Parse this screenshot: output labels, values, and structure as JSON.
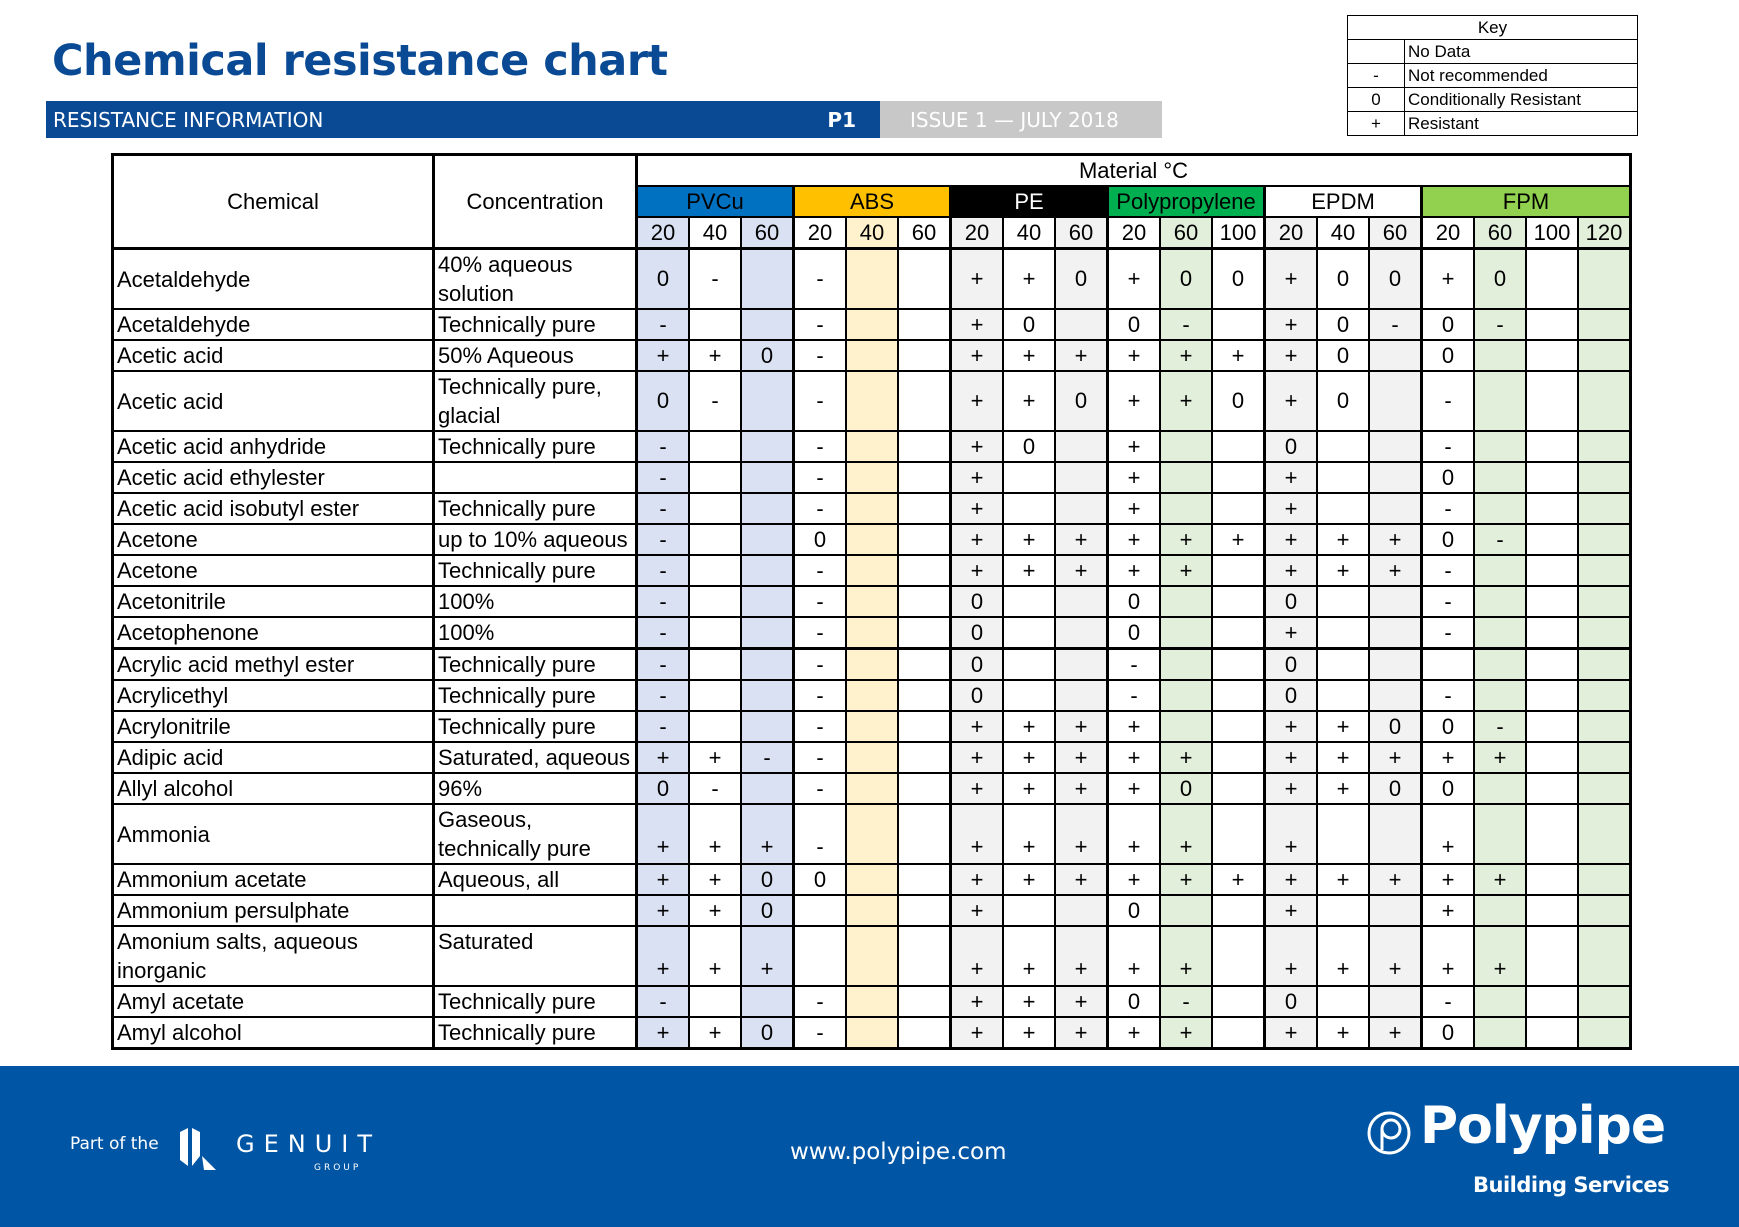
{
  "header": {
    "title": "Chemical resistance chart",
    "section": "RESISTANCE INFORMATION",
    "page": "P1",
    "issue": "ISSUE 1 — JULY 2018"
  },
  "key": {
    "title": "Key",
    "items": [
      {
        "symbol": "",
        "label": "No Data"
      },
      {
        "symbol": "-",
        "label": "Not recommended"
      },
      {
        "symbol": "0",
        "label": "Conditionally Resistant"
      },
      {
        "symbol": "+",
        "label": "Resistant"
      }
    ]
  },
  "table": {
    "col_chemical": "Chemical",
    "col_concentration": "Concentration",
    "material_title": "Material °C",
    "materials": [
      {
        "name": "PVCu",
        "color": "#0070c0",
        "text_color": "#000000",
        "temps": [
          "20",
          "40",
          "60"
        ],
        "shade": [
          true,
          false,
          true
        ],
        "shade_color": "#d9e1f2"
      },
      {
        "name": "ABS",
        "color": "#ffc000",
        "text_color": "#000000",
        "temps": [
          "20",
          "40",
          "60"
        ],
        "shade": [
          false,
          true,
          false
        ],
        "shade_color": "#fff2cc"
      },
      {
        "name": "PE",
        "color": "#000000",
        "text_color": "#ffffff",
        "temps": [
          "20",
          "40",
          "60"
        ],
        "shade": [
          true,
          false,
          true
        ],
        "shade_color": "#f2f2f2"
      },
      {
        "name": "Polypropylene",
        "color": "#00b050",
        "text_color": "#000000",
        "temps": [
          "20",
          "60",
          "100"
        ],
        "shade": [
          false,
          true,
          false
        ],
        "shade_color": "#e2efda"
      },
      {
        "name": "EPDM",
        "color": "#ffffff",
        "text_color": "#000000",
        "temps": [
          "20",
          "40",
          "60"
        ],
        "shade": [
          true,
          false,
          true
        ],
        "shade_color": "#f2f2f2"
      },
      {
        "name": "FPM",
        "color": "#92d050",
        "text_color": "#000000",
        "temps": [
          "20",
          "60",
          "100",
          "120"
        ],
        "shade": [
          false,
          true,
          false,
          true
        ],
        "shade_color": "#e2efda"
      }
    ],
    "rows": [
      {
        "chemical": "Acetaldehyde",
        "concentration": "40% aqueous solution",
        "tall": true,
        "values": [
          "0",
          "-",
          "",
          "-",
          "",
          "",
          "+",
          "+",
          "0",
          "+",
          "0",
          "0",
          "+",
          "0",
          "0",
          "+",
          "0",
          "",
          ""
        ]
      },
      {
        "chemical": "Acetaldehyde",
        "concentration": "Technically pure",
        "values": [
          "-",
          "",
          "",
          "-",
          "",
          "",
          "+",
          "0",
          "",
          "0",
          "-",
          "",
          "+",
          "0",
          "-",
          "0",
          "-",
          "",
          ""
        ]
      },
      {
        "chemical": "Acetic acid",
        "concentration": "50% Aqueous",
        "values": [
          "+",
          "+",
          "0",
          "-",
          "",
          "",
          "+",
          "+",
          "+",
          "+",
          "+",
          "+",
          "+",
          "0",
          "",
          "0",
          "",
          "",
          ""
        ]
      },
      {
        "chemical": "Acetic acid",
        "concentration": "Technically pure, glacial",
        "tall": true,
        "values": [
          "0",
          "-",
          "",
          "-",
          "",
          "",
          "+",
          "+",
          "0",
          "+",
          "+",
          "0",
          "+",
          "0",
          "",
          "-",
          "",
          "",
          ""
        ]
      },
      {
        "chemical": "Acetic acid anhydride",
        "concentration": "Technically pure",
        "values": [
          "-",
          "",
          "",
          "-",
          "",
          "",
          "+",
          "0",
          "",
          "+",
          "",
          "",
          "0",
          "",
          "",
          "-",
          "",
          "",
          ""
        ]
      },
      {
        "chemical": "Acetic acid ethylester",
        "concentration": "",
        "values": [
          "-",
          "",
          "",
          "-",
          "",
          "",
          "+",
          "",
          "",
          "+",
          "",
          "",
          "+",
          "",
          "",
          "0",
          "",
          "",
          ""
        ]
      },
      {
        "chemical": "Acetic acid isobutyl ester",
        "concentration": "Technically pure",
        "values": [
          "-",
          "",
          "",
          "-",
          "",
          "",
          "+",
          "",
          "",
          "+",
          "",
          "",
          "+",
          "",
          "",
          "-",
          "",
          "",
          ""
        ]
      },
      {
        "chemical": "Acetone",
        "concentration": "up to 10% aqueous",
        "values": [
          "-",
          "",
          "",
          "0",
          "",
          "",
          "+",
          "+",
          "+",
          "+",
          "+",
          "+",
          "+",
          "+",
          "+",
          "0",
          "-",
          "",
          ""
        ]
      },
      {
        "chemical": "Acetone",
        "concentration": "Technically pure",
        "values": [
          "-",
          "",
          "",
          "-",
          "",
          "",
          "+",
          "+",
          "+",
          "+",
          "+",
          "",
          "+",
          "+",
          "+",
          "-",
          "",
          "",
          ""
        ]
      },
      {
        "chemical": "Acetonitrile",
        "concentration": "100%",
        "values": [
          "-",
          "",
          "",
          "-",
          "",
          "",
          "0",
          "",
          "",
          "0",
          "",
          "",
          "0",
          "",
          "",
          "-",
          "",
          "",
          ""
        ]
      },
      {
        "chemical": "Acetophenone",
        "concentration": "100%",
        "values": [
          "-",
          "",
          "",
          "-",
          "",
          "",
          "0",
          "",
          "",
          "0",
          "",
          "",
          "+",
          "",
          "",
          "-",
          "",
          "",
          ""
        ]
      },
      {
        "chemical": "Acrylic acid methyl ester",
        "concentration": "Technically pure",
        "values": [
          "-",
          "",
          "",
          "-",
          "",
          "",
          "0",
          "",
          "",
          "-",
          "",
          "",
          "0",
          "",
          "",
          "",
          "",
          "",
          ""
        ]
      },
      {
        "chemical": "Acrylicethyl",
        "concentration": "Technically pure",
        "values": [
          "-",
          "",
          "",
          "-",
          "",
          "",
          "0",
          "",
          "",
          "-",
          "",
          "",
          "0",
          "",
          "",
          "-",
          "",
          "",
          ""
        ]
      },
      {
        "chemical": "Acrylonitrile",
        "concentration": "Technically pure",
        "values": [
          "-",
          "",
          "",
          "-",
          "",
          "",
          "+",
          "+",
          "+",
          "+",
          "",
          "",
          "+",
          "+",
          "0",
          "0",
          "-",
          "",
          ""
        ]
      },
      {
        "chemical": "Adipic acid",
        "concentration": "Saturated, aqueous",
        "values": [
          "+",
          "+",
          "-",
          "-",
          "",
          "",
          "+",
          "+",
          "+",
          "+",
          "+",
          "",
          "+",
          "+",
          "+",
          "+",
          "+",
          "",
          ""
        ]
      },
      {
        "chemical": "Allyl alcohol",
        "concentration": "96%",
        "values": [
          "0",
          "-",
          "",
          "-",
          "",
          "",
          "+",
          "+",
          "+",
          "+",
          "0",
          "",
          "+",
          "+",
          "0",
          "0",
          "",
          "",
          ""
        ]
      },
      {
        "chemical": "Ammonia",
        "concentration": "Gaseous, technically pure",
        "tall": true,
        "bottom": true,
        "values": [
          "+",
          "+",
          "+",
          "-",
          "",
          "",
          "+",
          "+",
          "+",
          "+",
          "+",
          "",
          "+",
          "",
          "",
          "+",
          "",
          "",
          ""
        ]
      },
      {
        "chemical": "Ammonium acetate",
        "concentration": "Aqueous, all",
        "values": [
          "+",
          "+",
          "0",
          "0",
          "",
          "",
          "+",
          "+",
          "+",
          "+",
          "+",
          "+",
          "+",
          "+",
          "+",
          "+",
          "+",
          "",
          ""
        ]
      },
      {
        "chemical": "Ammonium persulphate",
        "concentration": "",
        "values": [
          "+",
          "+",
          "0",
          "",
          "",
          "",
          "+",
          "",
          "",
          "0",
          "",
          "",
          "+",
          "",
          "",
          "+",
          "",
          "",
          ""
        ]
      },
      {
        "chemical": "Amonium salts, aqueous inorganic",
        "concentration": "Saturated",
        "tall": true,
        "bottom": true,
        "values": [
          "+",
          "+",
          "+",
          "",
          "",
          "",
          "+",
          "+",
          "+",
          "+",
          "+",
          "",
          "+",
          "+",
          "+",
          "+",
          "+",
          "",
          ""
        ]
      },
      {
        "chemical": "Amyl acetate",
        "concentration": "Technically pure",
        "values": [
          "-",
          "",
          "",
          "-",
          "",
          "",
          "+",
          "+",
          "+",
          "0",
          "-",
          "",
          "0",
          "",
          "",
          "-",
          "",
          "",
          ""
        ]
      },
      {
        "chemical": "Amyl alcohol",
        "concentration": "Technically pure",
        "values": [
          "+",
          "+",
          "0",
          "-",
          "",
          "",
          "+",
          "+",
          "+",
          "+",
          "+",
          "",
          "+",
          "+",
          "+",
          "0",
          "",
          "",
          ""
        ]
      }
    ]
  },
  "footer": {
    "part_of": "Part of the",
    "group_name": "GENUIT",
    "group_sub": "GROUP",
    "url": "www.polypipe.com",
    "brand": "Polypipe",
    "brand_sub": "Building Services",
    "bg_color": "#0055a4"
  }
}
